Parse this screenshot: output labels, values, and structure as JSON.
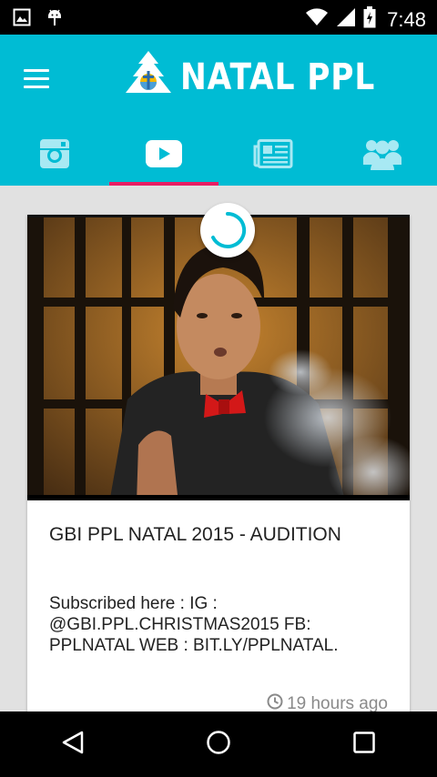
{
  "status_bar": {
    "time": "7:48",
    "icons": [
      "image-icon",
      "android-icon",
      "wifi-icon",
      "signal-icon",
      "battery-icon"
    ]
  },
  "app_bar": {
    "title": "NATAL PPL",
    "menu_icon": "hamburger-menu-icon",
    "logo_icon": "tree-logo-icon",
    "color": "#00bcd4"
  },
  "tabs": [
    {
      "icon": "instagram-icon",
      "active": false
    },
    {
      "icon": "youtube-icon",
      "active": true
    },
    {
      "icon": "news-icon",
      "active": false
    },
    {
      "icon": "group-icon",
      "active": false
    }
  ],
  "tab_indicator_color": "#e91e63",
  "card": {
    "title": "GBI PPL NATAL 2015 - AUDITION",
    "description": "Subscribed here : IG : @GBI.PPL.CHRISTMAS2015 FB: PPLNATAL WEB : BIT.LY/PPLNATAL.",
    "time": "19 hours ago",
    "time_icon": "clock-icon"
  },
  "nav_bar": {
    "buttons": [
      "back-icon",
      "home-icon",
      "recents-icon"
    ]
  }
}
